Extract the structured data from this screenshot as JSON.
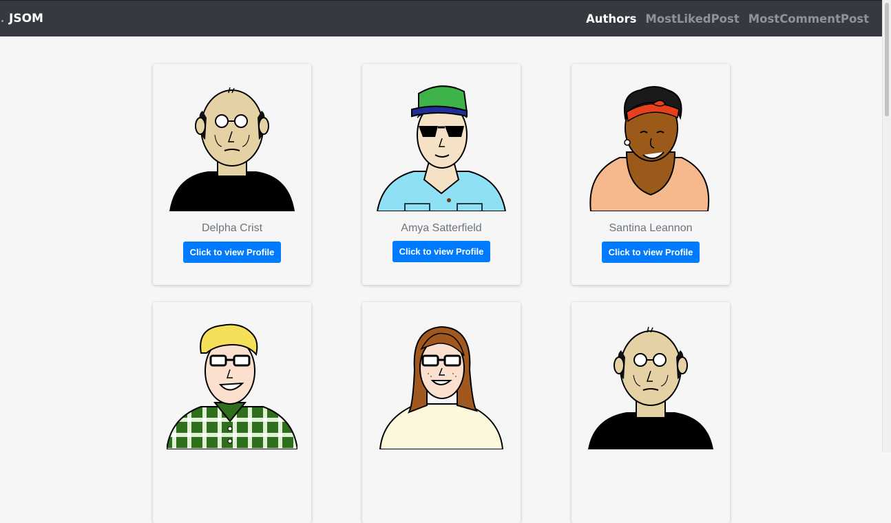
{
  "navbar": {
    "brand": "JSOM",
    "links": [
      {
        "label": "Authors",
        "active": true
      },
      {
        "label": "MostLikedPost",
        "active": false
      },
      {
        "label": "MostCommentPost",
        "active": false
      }
    ]
  },
  "colors": {
    "navbar_bg": "#343a40",
    "button_bg": "#007bff",
    "page_bg": "#f6f6f6"
  },
  "authors": [
    {
      "name": "Delpha Crist",
      "button_label": "Click to view Profile",
      "avatar": "bald-man-glasses-black-turtleneck"
    },
    {
      "name": "Amya Satterfield",
      "button_label": "Click to view Profile",
      "avatar": "man-green-cap-sunglasses-blue-shirt"
    },
    {
      "name": "Santina Leannon",
      "button_label": "Click to view Profile",
      "avatar": "woman-red-headband-peach-top"
    },
    {
      "name": "",
      "button_label": "",
      "avatar": "blond-man-glasses-plaid-shirt"
    },
    {
      "name": "",
      "button_label": "",
      "avatar": "woman-brown-hair-glasses-cream-top"
    },
    {
      "name": "",
      "button_label": "",
      "avatar": "bald-man-glasses-black-turtleneck"
    }
  ]
}
